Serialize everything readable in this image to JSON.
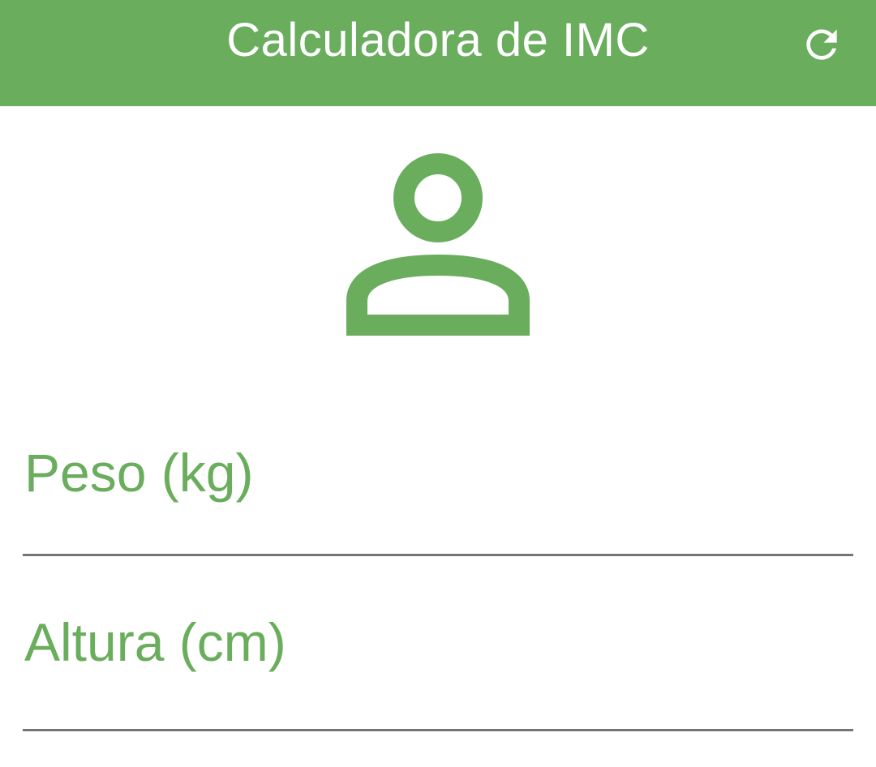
{
  "app_bar": {
    "title": "Calculadora de IMC",
    "background": "#69AD5D",
    "refresh_icon": "refresh-icon"
  },
  "avatar": {
    "icon": "person-outline-icon",
    "color": "#69AD5D"
  },
  "form": {
    "weight_label": "Peso (kg)",
    "weight_value": "",
    "height_label": "Altura (cm)",
    "height_value": ""
  },
  "colors": {
    "accent": "#69AD5D",
    "underline": "#757575"
  }
}
